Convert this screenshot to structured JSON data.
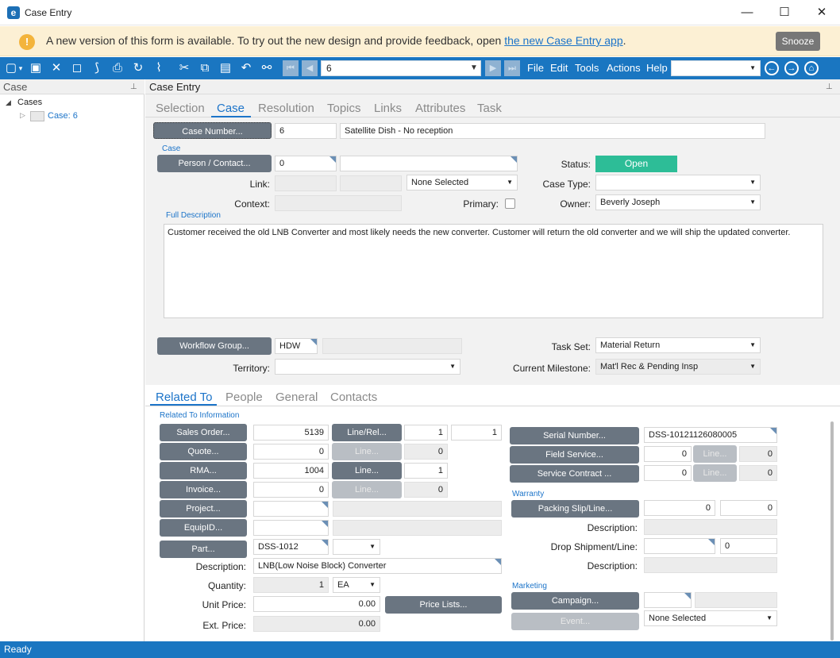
{
  "window": {
    "title": "Case Entry",
    "app_icon": "e",
    "minimize": "—",
    "maximize": "☐",
    "close": "✕"
  },
  "banner": {
    "icon": "!",
    "text": "A new version of this form is available. To try out the new design and provide feedback, open ",
    "link": "the new Case Entry app",
    "suffix": ".",
    "snooze": "Snooze"
  },
  "toolbar": {
    "record": "6",
    "menus": [
      "File",
      "Edit",
      "Tools",
      "Actions",
      "Help"
    ],
    "search_value": ""
  },
  "left_pane": {
    "title": "Case",
    "tree_root": "Cases",
    "tree_item": "Case: 6"
  },
  "right_pane": {
    "title": "Case Entry"
  },
  "tabs": [
    "Selection",
    "Case",
    "Resolution",
    "Topics",
    "Links",
    "Attributes",
    "Task"
  ],
  "case": {
    "case_number_btn": "Case Number...",
    "case_number": "6",
    "case_desc": "Satellite Dish - No reception",
    "section": "Case",
    "person_contact_btn": "Person / Contact...",
    "person_value": "0",
    "person_name": "",
    "link_label": "Link:",
    "link_select": "None Selected",
    "context_label": "Context:",
    "primary_label": "Primary:",
    "status_label": "Status:",
    "status_value": "Open",
    "case_type_label": "Case Type:",
    "case_type_value": "",
    "owner_label": "Owner:",
    "owner_value": "Beverly Joseph",
    "full_desc_label": "Full Description",
    "full_desc": "Customer received the old LNB Converter and most likely needs the new converter. Customer will return the old converter and we will ship the updated converter.",
    "workflow_btn": "Workflow Group...",
    "workflow_value": "HDW",
    "territory_label": "Territory:",
    "task_set_label": "Task Set:",
    "task_set_value": "Material Return",
    "milestone_label": "Current Milestone:",
    "milestone_value": "Mat'l Rec & Pending Insp"
  },
  "sub_tabs": [
    "Related To",
    "People",
    "General",
    "Contacts"
  ],
  "related": {
    "section": "Related To Information",
    "sales_order_btn": "Sales Order...",
    "sales_order": "5139",
    "line_rel_btn": "Line/Rel...",
    "line_rel_1": "1",
    "line_rel_2": "1",
    "quote_btn": "Quote...",
    "quote": "0",
    "line_btn": "Line...",
    "quote_line": "0",
    "rma_btn": "RMA...",
    "rma": "1004",
    "rma_line": "1",
    "invoice_btn": "Invoice...",
    "invoice": "0",
    "invoice_line": "0",
    "project_btn": "Project...",
    "equipid_btn": "EquipID...",
    "part_btn": "Part...",
    "part": "DSS-1012",
    "description_label": "Description:",
    "part_description": "LNB(Low Noise Block) Converter",
    "quantity_label": "Quantity:",
    "quantity": "1",
    "uom": "EA",
    "unit_price_label": "Unit Price:",
    "unit_price": "0.00",
    "price_lists_btn": "Price Lists...",
    "ext_price_label": "Ext. Price:",
    "ext_price": "0.00",
    "serial_btn": "Serial Number...",
    "serial": "DSS-10121126080005",
    "field_service_btn": "Field Service...",
    "field_service": "0",
    "field_service_line": "0",
    "service_contract_btn": "Service Contract ...",
    "service_contract": "0",
    "service_contract_line": "0",
    "warranty_section": "Warranty",
    "packing_btn": "Packing Slip/Line...",
    "packing_1": "0",
    "packing_2": "0",
    "desc_label": "Description:",
    "drop_ship_label": "Drop Shipment/Line:",
    "drop_ship_line": "0",
    "marketing_section": "Marketing",
    "campaign_btn": "Campaign...",
    "event_btn": "Event...",
    "event_select": "None Selected"
  },
  "status_bar": "Ready"
}
